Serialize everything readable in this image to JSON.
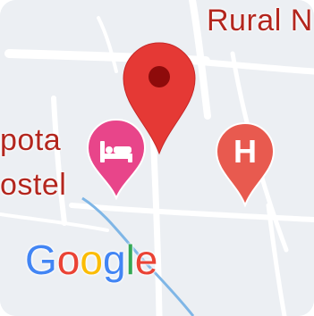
{
  "map": {
    "labels": {
      "rural": "Rural N",
      "pota": "pota",
      "hostel": "ostel"
    },
    "markers": [
      {
        "type": "location-pin",
        "color": "#e53935"
      },
      {
        "type": "hotel-pin",
        "color": "#e8458a"
      },
      {
        "type": "hospital-pin",
        "color": "#e85a4f",
        "glyph": "H"
      }
    ],
    "attribution": {
      "letters": [
        "G",
        "o",
        "o",
        "g",
        "l",
        "e"
      ],
      "colors": [
        "#4285F4",
        "#EA4335",
        "#FBBC05",
        "#4285F4",
        "#34A853",
        "#EA4335"
      ]
    },
    "colors": {
      "land": "#eceff3",
      "road": "#ffffff",
      "water": "#7fb6e6",
      "label": "#b3261e"
    }
  }
}
